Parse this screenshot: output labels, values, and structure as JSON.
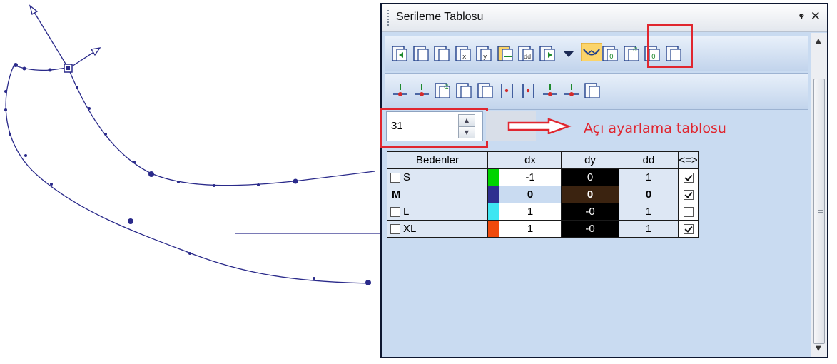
{
  "panel": {
    "title": "Serileme Tablosu",
    "pin_glyph": "ꟷ",
    "pin_label": "3",
    "close_label": "✕"
  },
  "toolbar_row1": [
    {
      "icon": "grade-left-icon"
    },
    {
      "icon": "piece-copy-icon"
    },
    {
      "icon": "piece-disabled-icon"
    },
    {
      "icon": "piece-x-icon"
    },
    {
      "icon": "piece-y-icon"
    },
    {
      "icon": "grade-shift-active-icon",
      "active": true
    },
    {
      "icon": "piece-dd-icon"
    },
    {
      "icon": "grade-right-icon"
    },
    {
      "icon": "dropdown-arrow-icon"
    },
    {
      "icon": "curve-angle-icon",
      "highlighted": true
    },
    {
      "icon": "ruler-zero-icon"
    },
    {
      "icon": "alpha-angle-icon"
    },
    {
      "icon": "piece-zero-icon"
    },
    {
      "icon": "layers-icon"
    }
  ],
  "toolbar_row2": [
    {
      "icon": "point-down-icon"
    },
    {
      "icon": "point-plus-icon"
    },
    {
      "icon": "alpha-copy-icon"
    },
    {
      "icon": "expand-piece-icon"
    },
    {
      "icon": "mirror-piece-icon"
    },
    {
      "icon": "split-line-icon"
    },
    {
      "icon": "arrow-into-line-icon"
    },
    {
      "icon": "distribute-icon"
    },
    {
      "icon": "diagonal-points-icon"
    },
    {
      "icon": "check-piece-icon"
    }
  ],
  "angle_input": {
    "value": "31"
  },
  "annotation": "Açı ayarlama tablosu",
  "table": {
    "headers": [
      "Bedenler",
      "",
      "dx",
      "dy",
      "dd",
      "<=>"
    ],
    "rows": [
      {
        "name": "S",
        "checkbox": true,
        "checked_name": false,
        "color": "#00d400",
        "dx": "-1",
        "dy": "0",
        "dd": "1",
        "link": true
      },
      {
        "name": "M",
        "checkbox": false,
        "bold": true,
        "color": "#2f2f8f",
        "dx": "0",
        "dy": "0",
        "dd": "0",
        "link": true
      },
      {
        "name": "L",
        "checkbox": true,
        "checked_name": false,
        "color": "#3ee6f2",
        "dx": "1",
        "dy": "-0",
        "dd": "1",
        "link": false
      },
      {
        "name": "XL",
        "checkbox": true,
        "checked_name": false,
        "color": "#f04a0c",
        "dx": "1",
        "dy": "-0",
        "dd": "1",
        "link": true
      }
    ]
  },
  "colors": {
    "accent_red": "#e0262f",
    "curve_blue": "#2a2a8a",
    "panel_bg": "#c9dbf1"
  }
}
